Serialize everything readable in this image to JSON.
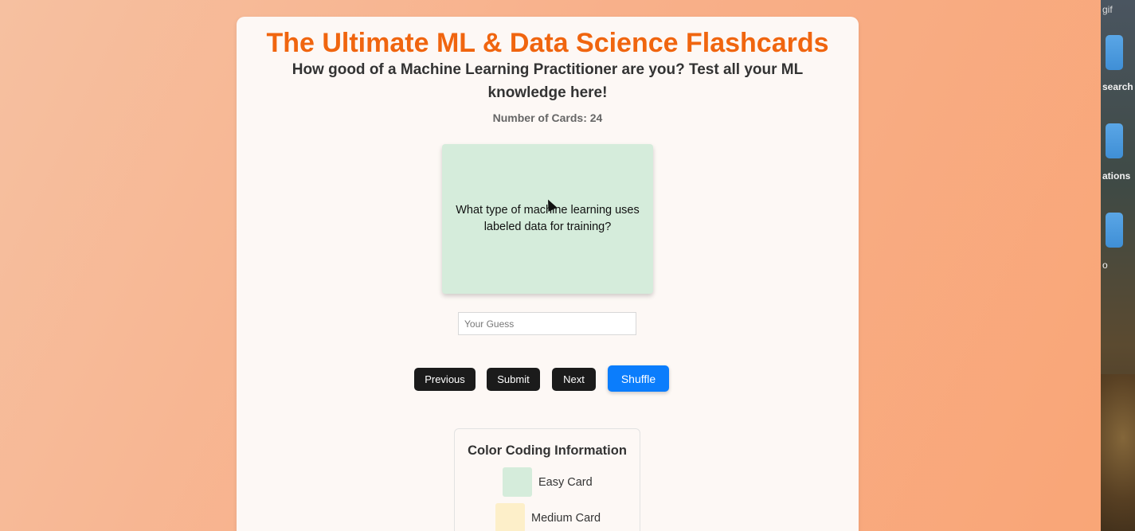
{
  "app": {
    "title": "The Ultimate ML & Data Science Flashcards",
    "subtitle": "How good of a Machine Learning Practitioner are you? Test all your ML knowledge here!",
    "card_count_text": "Number of Cards: 24"
  },
  "card": {
    "question": "What type of machine learning uses labeled data for training?",
    "difficulty": "easy",
    "color": "#d5ecdb"
  },
  "guess_input": {
    "value": "",
    "placeholder": "Your Guess"
  },
  "controls": {
    "previous_label": "Previous",
    "submit_label": "Submit",
    "next_label": "Next",
    "shuffle_label": "Shuffle"
  },
  "legend": {
    "title": "Color Coding Information",
    "items": [
      {
        "label": "Easy Card",
        "color": "#d5ecdb"
      },
      {
        "label": "Medium Card",
        "color": "#fdefc9"
      }
    ]
  },
  "desktop": {
    "labels": [
      "gif",
      "search",
      "ations",
      "o"
    ]
  },
  "colors": {
    "title": "#f0650f",
    "shuffle": "#0b7dfc",
    "button_dark": "#1b1b1b",
    "panel": "#fdf8f5"
  }
}
